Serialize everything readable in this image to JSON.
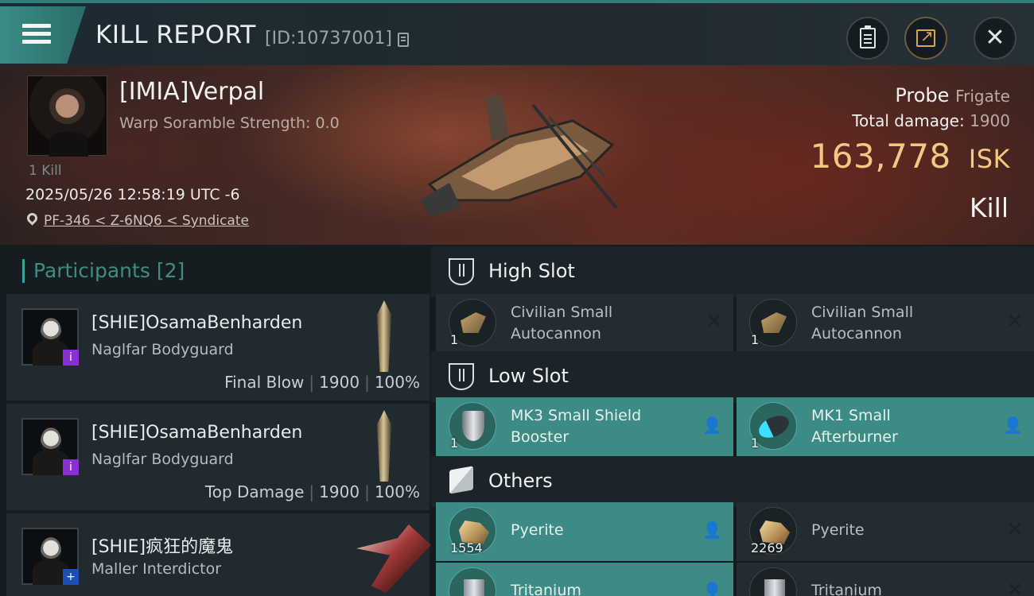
{
  "header": {
    "title": "KILL REPORT",
    "report_id": "[ID:10737001]",
    "buttons": [
      "clipboard-icon",
      "share-icon",
      "close-icon"
    ],
    "close_glyph": "✕"
  },
  "victim": {
    "pilot": "[IMIA]Verpal",
    "scramble": "Warp Soramble Strength: 0.0",
    "kill_count": "1 Kill",
    "timestamp": "2025/05/26 12:58:19 UTC -6",
    "location": "PF-346 < Z-6NQ6 < Syndicate",
    "ship_name": "Probe",
    "ship_class": "Frigate",
    "total_damage_label": "Total damage:",
    "total_damage": "1900",
    "isk_value": "163,778",
    "isk_unit": "ISK",
    "result": "Kill"
  },
  "participants": {
    "label": "Participants",
    "count": "[2]",
    "rows": [
      {
        "name": "[SHIE]OsamaBenharden",
        "ship": "Naglfar Bodyguard",
        "role": "Final Blow",
        "damage": "1900",
        "percent": "100%",
        "badge": "i"
      },
      {
        "name": "[SHIE]OsamaBenharden",
        "ship": "Naglfar Bodyguard",
        "role": "Top Damage",
        "damage": "1900",
        "percent": "100%",
        "badge": "i"
      },
      {
        "name": "[SHIE]疯狂的魔鬼",
        "ship": "Maller Interdictor",
        "badge": "+"
      }
    ]
  },
  "fitting": {
    "high_slot": {
      "label": "High Slot",
      "items": [
        {
          "name": "Civilian Small Autocannon",
          "line1": "Civilian Small",
          "line2": "Autocannon",
          "qty": "1",
          "state": "destroyed",
          "state_glyph": "✕"
        },
        {
          "name": "Civilian Small Autocannon",
          "line1": "Civilian Small",
          "line2": "Autocannon",
          "qty": "1",
          "state": "destroyed",
          "state_glyph": "✕"
        }
      ]
    },
    "low_slot": {
      "label": "Low Slot",
      "items": [
        {
          "line1": "MK3 Small Shield",
          "line2": "Booster",
          "qty": "1",
          "state": "dropped"
        },
        {
          "line1": "MK1 Small",
          "line2": "Afterburner",
          "qty": "1",
          "state": "dropped"
        }
      ]
    },
    "others": {
      "label": "Others",
      "items": [
        {
          "name": "Pyerite",
          "qty": "1554",
          "state": "dropped"
        },
        {
          "name": "Pyerite",
          "qty": "2269",
          "state": "destroyed",
          "state_glyph": "✕"
        },
        {
          "name": "Tritanium",
          "state": "dropped"
        },
        {
          "name": "Tritanium",
          "state": "destroyed",
          "state_glyph": "✕"
        }
      ]
    },
    "person_glyph": "👤"
  },
  "colors": {
    "accent": "#3c8b84",
    "isk": "#f3c882",
    "banner": "#4a2a24"
  }
}
